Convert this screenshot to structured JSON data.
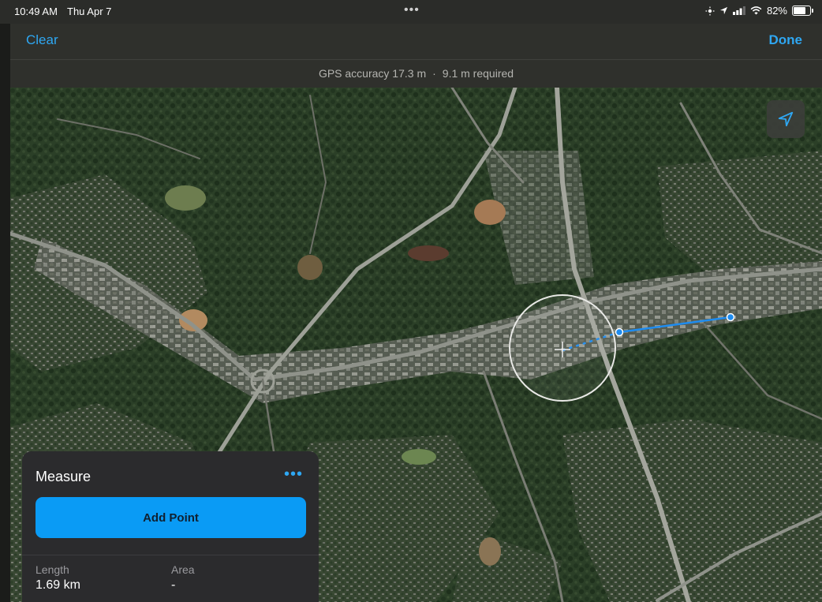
{
  "status_bar": {
    "time": "10:49 AM",
    "date": "Thu Apr 7",
    "battery": "82%",
    "battery_level": 0.82,
    "icons": [
      "brightness-icon",
      "location-arrow-icon",
      "signal-icon",
      "wifi-icon",
      "battery-icon"
    ]
  },
  "nav": {
    "clear_label": "Clear",
    "done_label": "Done"
  },
  "gps": {
    "accuracy": "GPS accuracy 17.3 m",
    "separator": "·",
    "required": "9.1 m required"
  },
  "map": {
    "type": "satellite",
    "locate_icon": "location-arrow-icon"
  },
  "measure": {
    "title": "Measure",
    "more_icon": "ellipsis-icon",
    "more_label": "•••",
    "add_point_label": "Add Point",
    "length_label": "Length",
    "length_value": "1.69 km",
    "area_label": "Area",
    "area_value": "-"
  },
  "colors": {
    "accent": "#2fa7f2",
    "button": "#0a9bf5",
    "bar_bg": "#2f302c",
    "panel_bg": "#2b2b2d",
    "measure_line": "#1e8cf0"
  }
}
